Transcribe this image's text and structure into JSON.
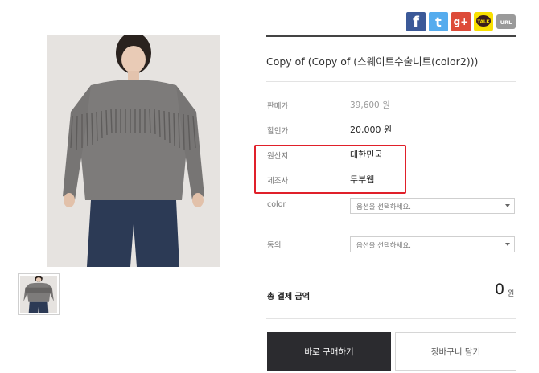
{
  "share": {
    "facebook": "f",
    "twitter": "t",
    "google": "g+",
    "talk": "TALK",
    "url": "URL"
  },
  "product": {
    "title": "Copy of (Copy of (스웨이트수술니트(color2)))",
    "image_alt": "",
    "rows": [
      {
        "label": "판매가",
        "value": "39,600 원"
      },
      {
        "label": "할인가",
        "value": "20,000 원"
      },
      {
        "label": "원산지",
        "value": "대한민국"
      },
      {
        "label": "제조사",
        "value": "두부웹"
      }
    ],
    "options": [
      {
        "label": "color",
        "placeholder": "옵션을 선택하세요."
      },
      {
        "label": "동의",
        "placeholder": "옵션을 선택하세요."
      }
    ],
    "total": {
      "label": "총 결제 금액",
      "value": "0",
      "unit": "원"
    },
    "buttons": {
      "buy": "바로 구매하기",
      "cart": "장바구니 담기"
    }
  },
  "colors": {
    "highlight": "#e0202a",
    "buy_button": "#2b2b2f",
    "facebook": "#3b5998",
    "twitter": "#55acee",
    "google": "#dd4b39"
  }
}
